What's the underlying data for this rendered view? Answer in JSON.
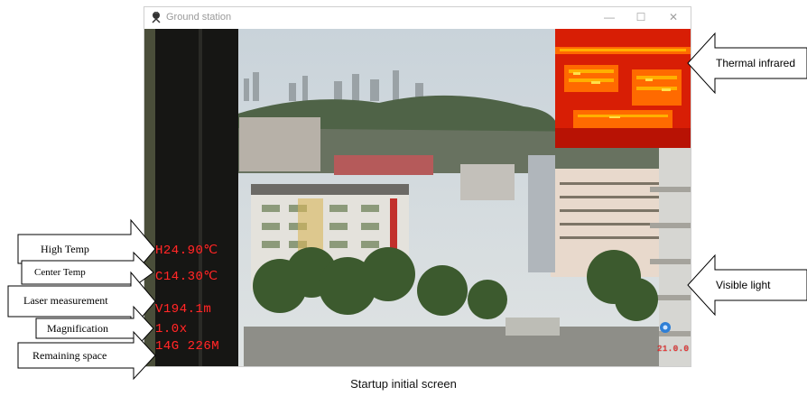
{
  "window": {
    "title": "Ground station",
    "minimize_glyph": "—",
    "maximize_glyph": "☐",
    "close_glyph": "✕"
  },
  "overlay": {
    "high_temp": "H24.90℃",
    "center_temp": "C14.30℃",
    "laser": "V194.1m",
    "magnification": "1.0x",
    "remaining_space": "14G 226M",
    "corner_readout": "21.0.0"
  },
  "callouts": {
    "high_temp": "High Temp",
    "center_temp": "Center Temp",
    "laser_measurement": "Laser measurement",
    "magnification": "Magnification",
    "remaining_space": "Remaining space",
    "thermal_infrared": "Thermal infrared",
    "visible_light": "Visible light"
  },
  "caption": "Startup initial screen",
  "colors": {
    "overlay_text": "#ff2a2a",
    "thermal_base": "#d81e05",
    "thermal_hot": "#ffd400"
  },
  "icons": {
    "app": "camera-tripod-icon",
    "record": "camera-record-icon"
  }
}
